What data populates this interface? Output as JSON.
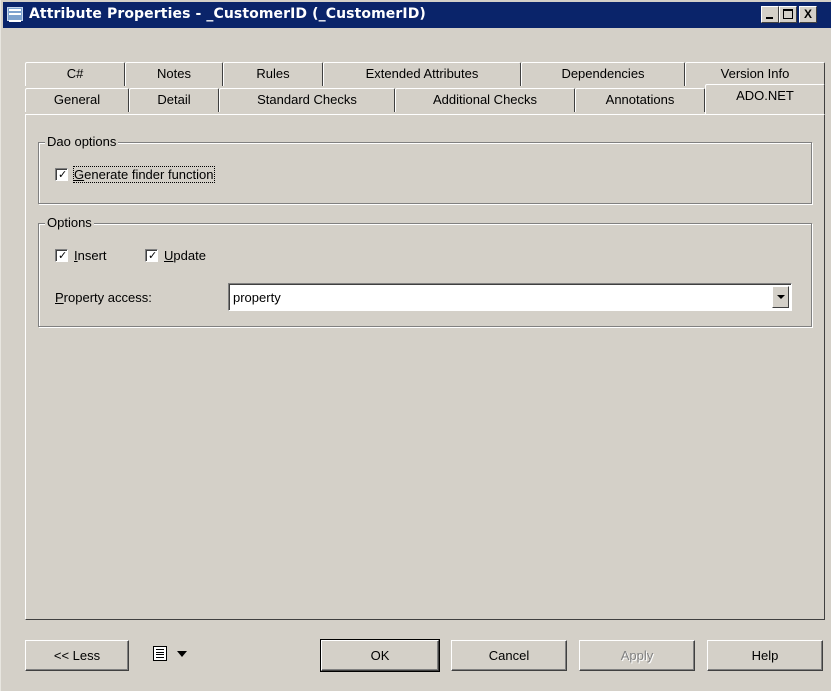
{
  "window": {
    "title": "Attribute Properties - _CustomerID (_CustomerID)",
    "controls": {
      "minimize": "_",
      "maximize": "□",
      "close": "X"
    }
  },
  "tabs": {
    "row1": [
      "C#",
      "Notes",
      "Rules",
      "Extended Attributes",
      "Dependencies",
      "Version Info"
    ],
    "row2": [
      "General",
      "Detail",
      "Standard Checks",
      "Additional Checks",
      "Annotations",
      "ADO.NET"
    ],
    "active": "ADO.NET"
  },
  "dao_group": {
    "legend": "Dao options",
    "generate_finder": {
      "label_underlined": "G",
      "label_rest": "enerate finder function",
      "checked": true
    }
  },
  "options_group": {
    "legend": "Options",
    "insert": {
      "label_underlined": "I",
      "label_rest": "nsert",
      "checked": true
    },
    "update": {
      "label_underlined": "U",
      "label_rest": "pdate",
      "checked": true
    },
    "property_access_label_underlined": "P",
    "property_access_label_rest": "roperty access:",
    "property_access_value": "property"
  },
  "buttons": {
    "less": "<< Less",
    "ok": "OK",
    "cancel": "Cancel",
    "apply": "Apply",
    "help": "Help"
  },
  "icons": {
    "menu": "list-icon",
    "dropdown": "triangle-down-icon"
  },
  "colors": {
    "titlebar": "#0a246a",
    "face": "#d4d0c8"
  }
}
